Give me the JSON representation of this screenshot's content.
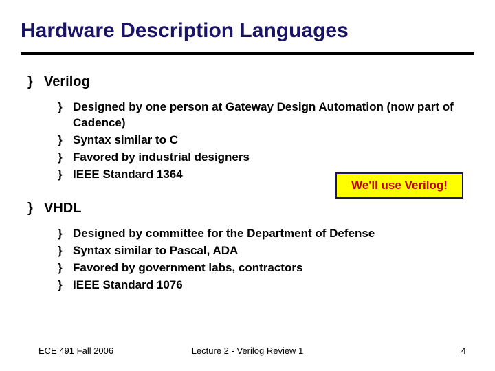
{
  "title": "Hardware Description Languages",
  "bullet_major": "}",
  "bullet_minor": "}",
  "sections": [
    {
      "heading": "Verilog",
      "items": [
        "Designed by one person at Gateway Design Automation (now part of Cadence)",
        "Syntax similar to C",
        "Favored by industrial designers",
        "IEEE Standard 1364"
      ]
    },
    {
      "heading": "VHDL",
      "items": [
        "Designed by committee for the Department of Defense",
        "Syntax similar to Pascal, ADA",
        "Favored by government labs, contractors",
        "IEEE Standard 1076"
      ]
    }
  ],
  "callout": "We'll use Verilog!",
  "footer": {
    "left": "ECE 491 Fall 2006",
    "center": "Lecture 2 - Verilog Review 1",
    "right": "4"
  }
}
